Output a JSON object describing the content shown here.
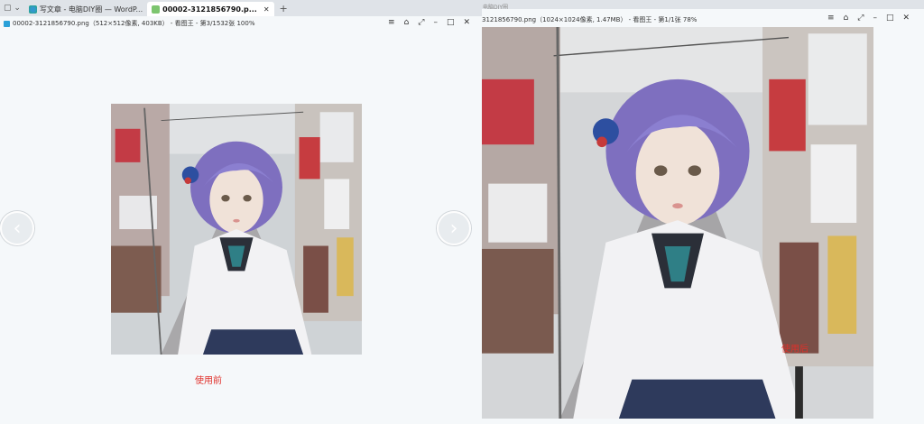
{
  "browser": {
    "tabs": [
      {
        "label": "写文章 - 电脑DIY圈 — WordP...",
        "active": false,
        "icon": "edge-icon"
      },
      {
        "label": "00002-3121856790.p...",
        "active": true,
        "icon": "image-icon"
      }
    ],
    "new_tab": "+",
    "background_title": "电脑DIY圈"
  },
  "left_viewer": {
    "title": "00002-3121856790.png（512×512像素, 403KB） - 看图王 - 第3/1532张 100%",
    "caption": "使用前",
    "prev_icon": "‹",
    "next_icon": "›"
  },
  "right_viewer": {
    "title": "3121856790.png（1024×1024像素, 1.47MB） - 看图王 - 第1/1张 78%",
    "caption": "使用后"
  },
  "controls": {
    "menu": "≡",
    "skin": "⌂",
    "fullscreen": "⤢",
    "minimize": "–",
    "maximize": "□",
    "close": "✕"
  },
  "colors": {
    "caption": "#e0302a",
    "hair": "#8b7fd0",
    "shirt": "#f2f2f4",
    "skirt": "#2e3a5c"
  }
}
